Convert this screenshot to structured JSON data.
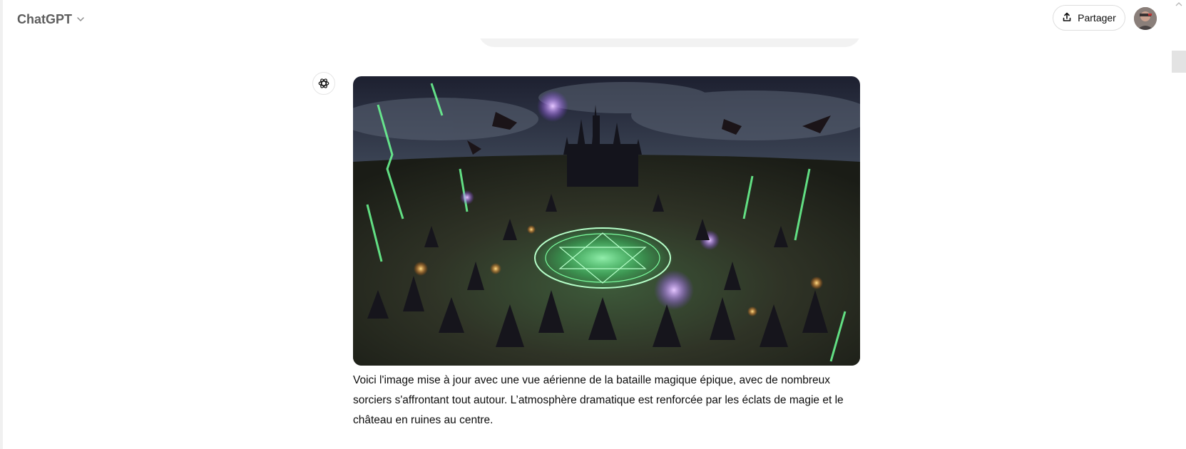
{
  "header": {
    "model_name": "ChatGPT",
    "share_label": "Partager"
  },
  "assistant": {
    "message": "Voici l'image mise à jour avec une vue aérienne de la bataille magique épique, avec de nombreux sorciers s'affrontant tout autour. L’atmosphère dramatique est renforcée par les éclats de magie et le château en ruines au centre."
  },
  "previous_user": {
    "fragment": "' ' ' "
  },
  "icons": {
    "model_dropdown": "chevron-down-icon",
    "share": "share-upload-icon",
    "assistant": "openai-logo-icon",
    "scroll_up": "chevron-up-icon"
  },
  "colors": {
    "magic_green": "#5cff8f",
    "magic_purple": "#b46cff",
    "fire": "#ff8a2a",
    "sky_dark": "#2a2d3a",
    "ground": "#3b3a2a"
  }
}
